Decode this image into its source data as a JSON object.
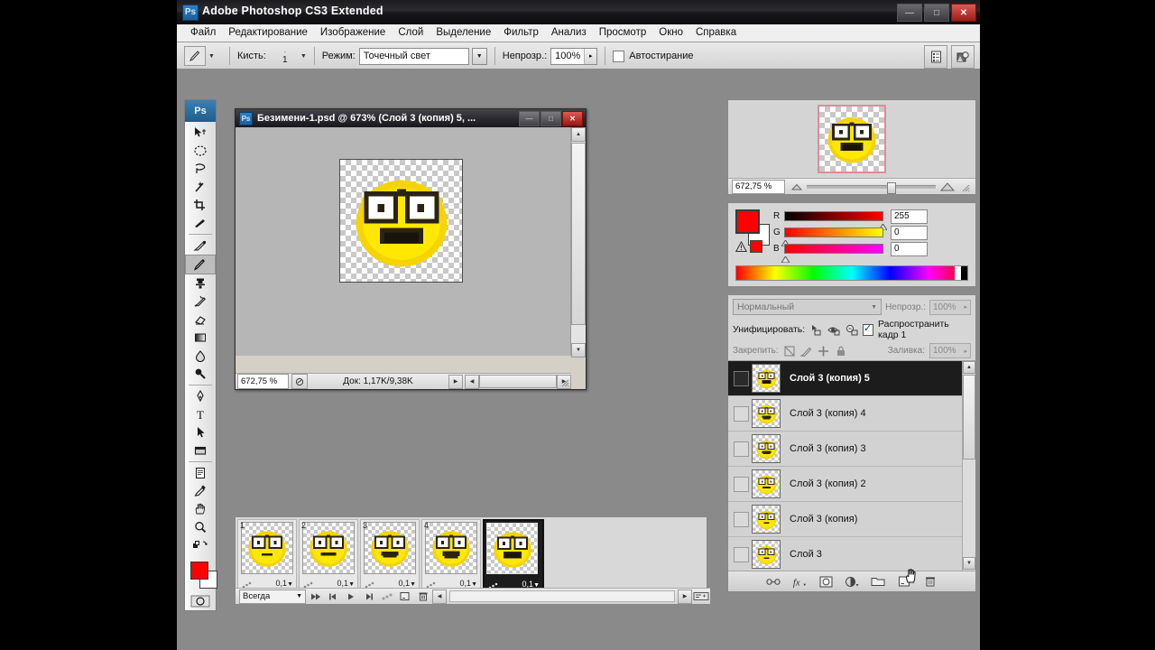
{
  "app": {
    "title": "Adobe Photoshop CS3 Extended",
    "badge": "Ps",
    "window_buttons": {
      "minimize": "—",
      "maximize": "□",
      "close": "✕"
    }
  },
  "menubar": {
    "items": [
      {
        "label": "Файл"
      },
      {
        "label": "Редактирование"
      },
      {
        "label": "Изображение"
      },
      {
        "label": "Слой"
      },
      {
        "label": "Выделение"
      },
      {
        "label": "Фильтр"
      },
      {
        "label": "Анализ"
      },
      {
        "label": "Просмотр"
      },
      {
        "label": "Окно"
      },
      {
        "label": "Справка"
      }
    ]
  },
  "options_bar": {
    "brush_label": "Кисть:",
    "brush_size": "1",
    "mode_label": "Режим:",
    "mode_value": "Точечный свет",
    "opacity_label": "Непрозр.:",
    "opacity_value": "100%",
    "autoerase_label": "Автостирание",
    "right_icons": [
      "palettes-icon",
      "bridge-icon"
    ]
  },
  "toolbox": {
    "badge": "Ps",
    "tools": [
      {
        "name": "move-tool"
      },
      {
        "name": "elliptical-marquee-tool"
      },
      {
        "name": "lasso-tool"
      },
      {
        "name": "magic-wand-tool"
      },
      {
        "name": "crop-tool"
      },
      {
        "name": "slice-tool"
      },
      {
        "name": "healing-brush-tool"
      },
      {
        "name": "brush-tool",
        "selected": true
      },
      {
        "name": "clone-stamp-tool"
      },
      {
        "name": "history-brush-tool"
      },
      {
        "name": "eraser-tool"
      },
      {
        "name": "gradient-tool"
      },
      {
        "name": "blur-tool"
      },
      {
        "name": "dodge-tool"
      },
      {
        "name": "pen-tool"
      },
      {
        "name": "type-tool"
      },
      {
        "name": "path-selection-tool"
      },
      {
        "name": "rectangle-shape-tool"
      },
      {
        "name": "notes-tool"
      },
      {
        "name": "eyedropper-tool"
      },
      {
        "name": "hand-tool"
      },
      {
        "name": "zoom-tool"
      }
    ],
    "foreground_color": "#ff0000",
    "background_color": "#ffffff"
  },
  "document": {
    "title": "Безимени-1.psd @ 673% (Слой 3 (копия) 5, ...",
    "badge": "Ps",
    "zoom": "672,75 %",
    "doc_info": "Док: 1,17K/9,38K",
    "window_buttons": {
      "minimize": "—",
      "maximize": "□",
      "close": "✕"
    }
  },
  "navigator": {
    "zoom_value": "672,75 %"
  },
  "color_panel": {
    "channels": [
      {
        "label": "R",
        "value": "255",
        "from": "#000000",
        "to": "#ff0000",
        "knob": 100
      },
      {
        "label": "G",
        "value": "0",
        "from": "#ff0000",
        "to": "#ffff00",
        "knob": 0
      },
      {
        "label": "B",
        "value": "0",
        "from": "#ff0000",
        "to": "#ff00ff",
        "knob": 0
      }
    ],
    "foreground": "#ff0000",
    "background": "#ffffff",
    "warning_swatch": "#ff0000"
  },
  "layers_panel": {
    "blend_mode": "Нормальный",
    "opacity_label": "Непрозр.:",
    "opacity_value": "100%",
    "unify_label": "Унифицировать:",
    "propagate_label": "Распространить кадр 1",
    "lock_label": "Закрепить:",
    "fill_label": "Заливка:",
    "fill_value": "100%",
    "layers": [
      {
        "name": "Слой 3 (копия) 5",
        "selected": true,
        "visible": false,
        "face": 5
      },
      {
        "name": "Слой 3 (копия) 4",
        "selected": false,
        "visible": false,
        "face": 4
      },
      {
        "name": "Слой 3 (копия) 3",
        "selected": false,
        "visible": false,
        "face": 3
      },
      {
        "name": "Слой 3 (копия) 2",
        "selected": false,
        "visible": false,
        "face": 2
      },
      {
        "name": "Слой 3 (копия)",
        "selected": false,
        "visible": false,
        "face": 1
      },
      {
        "name": "Слой 3",
        "selected": false,
        "visible": false,
        "face": 1
      }
    ],
    "bottom_icons": [
      "link-layers-icon",
      "layer-style-fx-icon",
      "layer-mask-icon",
      "adjustment-layer-icon",
      "new-group-icon",
      "new-layer-icon",
      "delete-layer-icon"
    ]
  },
  "animation_panel": {
    "loop_value": "Всегда",
    "frames": [
      {
        "number": "1",
        "delay": "0,1",
        "selected": false,
        "face": 1
      },
      {
        "number": "2",
        "delay": "0,1",
        "selected": false,
        "face": 2
      },
      {
        "number": "3",
        "delay": "0,1",
        "selected": false,
        "face": 3
      },
      {
        "number": "4",
        "delay": "0,1",
        "selected": false,
        "face": 4
      },
      {
        "number": "5",
        "delay": "0,1",
        "selected": true,
        "face": 5
      }
    ],
    "controls": [
      "select-first-frame-icon",
      "select-previous-frame-icon",
      "play-animation-icon",
      "select-next-frame-icon",
      "tween-frames-icon",
      "duplicate-frame-icon",
      "delete-frame-icon"
    ]
  },
  "colors": {
    "accent_red": "#ff0000",
    "selection_dark": "#1c1c1c",
    "panel_gray": "#d6d6d6",
    "workspace_gray": "#8a8a8a"
  }
}
